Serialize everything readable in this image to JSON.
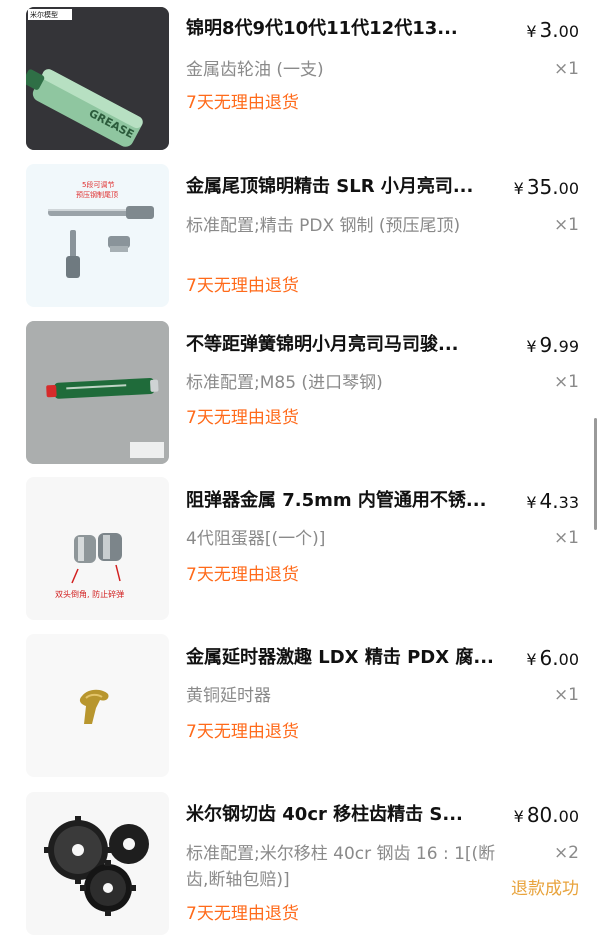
{
  "colors": {
    "promo": "#ff6a1a",
    "status": "#e8a33c",
    "muted": "#8a8a8a"
  },
  "items": [
    {
      "title": "锦明8代9代10代11代12代13...",
      "currency": "¥",
      "price_int": "3.",
      "price_dec": "00",
      "spec": "金属齿轮油 (一支)",
      "qty": "×1",
      "tag": "7天无理由退货",
      "image": {
        "icon": "grease-tube-image",
        "text_top": "米尔模型",
        "text_label": "GREASE"
      }
    },
    {
      "title": "金属尾顶锦明精击 SLR 小月亮司...",
      "currency": "¥",
      "price_int": "35.",
      "price_dec": "00",
      "spec": "标准配置;精击 PDX 钢制 (预压尾顶)",
      "qty": "×1",
      "tag": "7天无理由退货",
      "image": {
        "icon": "tail-pin-image",
        "text_1": "5段可调节",
        "text_2": "预压钢制尾顶"
      }
    },
    {
      "title": "不等距弹簧锦明小月亮司马司骏...",
      "currency": "¥",
      "price_int": "9.",
      "price_dec": "99",
      "spec": "标准配置;M85 (进口琴钢)",
      "qty": "×1",
      "tag": "7天无理由退货",
      "image": {
        "icon": "spring-tube-image"
      }
    },
    {
      "title": "阻弹器金属 7.5mm 内管通用不锈...",
      "currency": "¥",
      "price_int": "4.",
      "price_dec": "33",
      "spec": "4代阻蛋器[(一个)]",
      "qty": "×1",
      "tag": "7天无理由退货",
      "image": {
        "icon": "bullet-stopper-image",
        "caption": "双头倒角, 防止碎弹"
      }
    },
    {
      "title": "金属延时器激趣 LDX 精击 PDX 腐...",
      "currency": "¥",
      "price_int": "6.",
      "price_dec": "00",
      "spec": "黄铜延时器",
      "qty": "×1",
      "tag": "7天无理由退货",
      "image": {
        "icon": "brass-delayer-image"
      }
    },
    {
      "title": "米尔钢切齿 40cr 移柱齿精击 S...",
      "currency": "¥",
      "price_int": "80.",
      "price_dec": "00",
      "spec": "标准配置;米尔移柱 40cr 钢齿 16 : 1[(断齿,断轴包赔)]",
      "qty": "×2",
      "status": "退款成功",
      "tag": "7天无理由退货",
      "image": {
        "icon": "gears-image"
      }
    }
  ]
}
